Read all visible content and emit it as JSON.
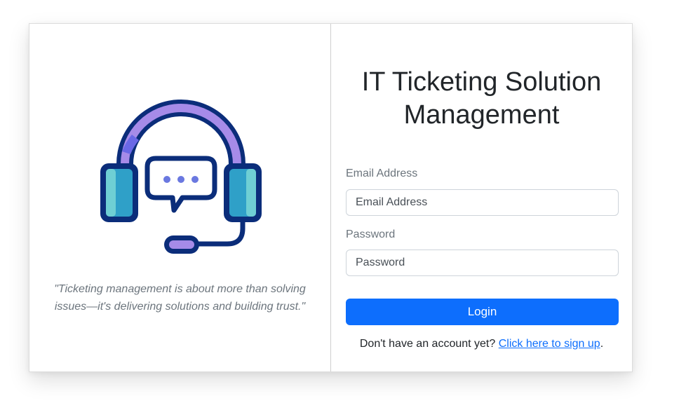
{
  "left_panel": {
    "logo_icon": "headset-support-chat-icon",
    "quote": "\"Ticketing management is about more than solving issues—it's delivering solutions and building trust.\""
  },
  "login_form": {
    "title": "IT Ticketing Solution Management",
    "email_label": "Email Address",
    "email_placeholder": "Email Address",
    "email_value": "",
    "password_label": "Password",
    "password_placeholder": "Password",
    "password_value": "",
    "login_button": "Login",
    "signup_prompt": "Don't have an account yet?",
    "signup_link": "Click here to sign up",
    "signup_suffix": "."
  },
  "colors": {
    "primary": "#0d6efd",
    "headset_dark": "#0b2d7a",
    "headset_purple": "#a68be8",
    "headset_teal": "#2fa0c8",
    "headset_light_teal": "#6fcfd4",
    "dots_blue": "#6a78e0"
  }
}
